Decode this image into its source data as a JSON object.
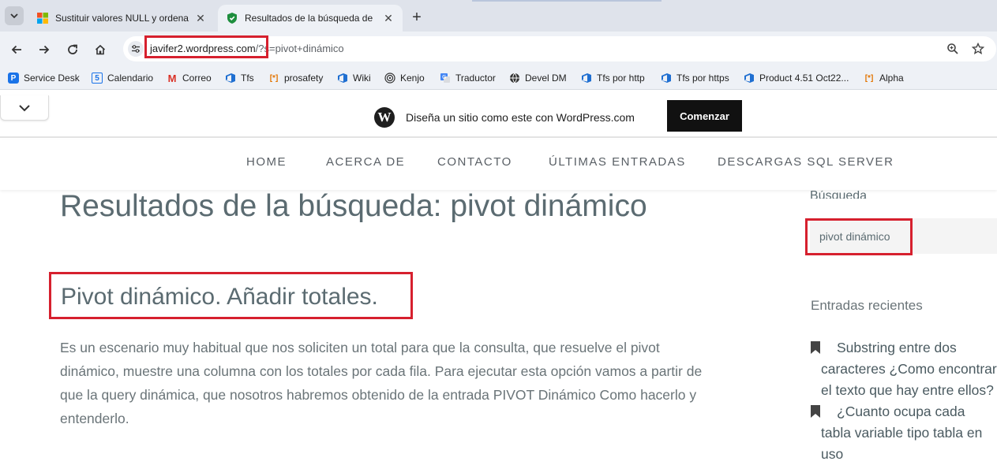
{
  "browser": {
    "tabs": [
      {
        "title": "Sustituir valores NULL y ordena",
        "favicon": "windows-logo-icon"
      },
      {
        "title": "Resultados de la búsqueda de",
        "favicon": "shield-icon"
      }
    ],
    "address": {
      "host": "javifer2.wordpress.com",
      "path": "/?s=pivot+dinámico"
    },
    "bookmarks": [
      {
        "label": "Service Desk",
        "icon": "pipe-icon"
      },
      {
        "label": "Calendario",
        "icon": "calendar-icon"
      },
      {
        "label": "Correo",
        "icon": "gmail-icon"
      },
      {
        "label": "Tfs",
        "icon": "azure-devops-icon"
      },
      {
        "label": "prosafety",
        "icon": "bracket-star-icon"
      },
      {
        "label": "Wiki",
        "icon": "azure-devops-icon"
      },
      {
        "label": "Kenjo",
        "icon": "fingerprint-icon"
      },
      {
        "label": "Traductor",
        "icon": "translate-icon"
      },
      {
        "label": "Devel DM",
        "icon": "globe-icon"
      },
      {
        "label": "Tfs por http",
        "icon": "azure-devops-icon"
      },
      {
        "label": "Tfs por https",
        "icon": "azure-devops-icon"
      },
      {
        "label": "Product 4.51 Oct22...",
        "icon": "azure-devops-icon"
      },
      {
        "label": "Alpha",
        "icon": "bracket-star-icon"
      }
    ]
  },
  "wp_banner": {
    "text": "Diseña un sitio como este con WordPress.com",
    "button": "Comenzar",
    "logo": "W"
  },
  "nav": [
    "HOME",
    "ACERCA DE",
    "CONTACTO",
    "ÚLTIMAS ENTRADAS",
    "DESCARGAS SQL SERVER"
  ],
  "main": {
    "page_title": "Resultados de la búsqueda: pivot dinámico",
    "post_title": "Pivot dinámico. Añadir totales.",
    "excerpt": "Es un escenario muy habitual que nos soliciten un total para que la consulta, que resuelve el pivot dinámico, muestre una columna con los totales por cada fila. Para ejecutar esta opción vamos a partir de que la query dinámica, que nosotros habremos obtenido de la entrada PIVOT Dinámico Como hacerlo y entenderlo."
  },
  "sidebar": {
    "search_heading": "Búsqueda",
    "search_value": "pivot dinámico",
    "recent_heading": "Entradas recientes",
    "recent": [
      "Substring entre dos caracteres ¿Como encontrar el texto que hay entre ellos?",
      "¿Cuanto ocupa cada tabla variable tipo tabla en uso"
    ]
  },
  "colors": {
    "highlight": "#d6202e",
    "title": "#5b6b71"
  }
}
